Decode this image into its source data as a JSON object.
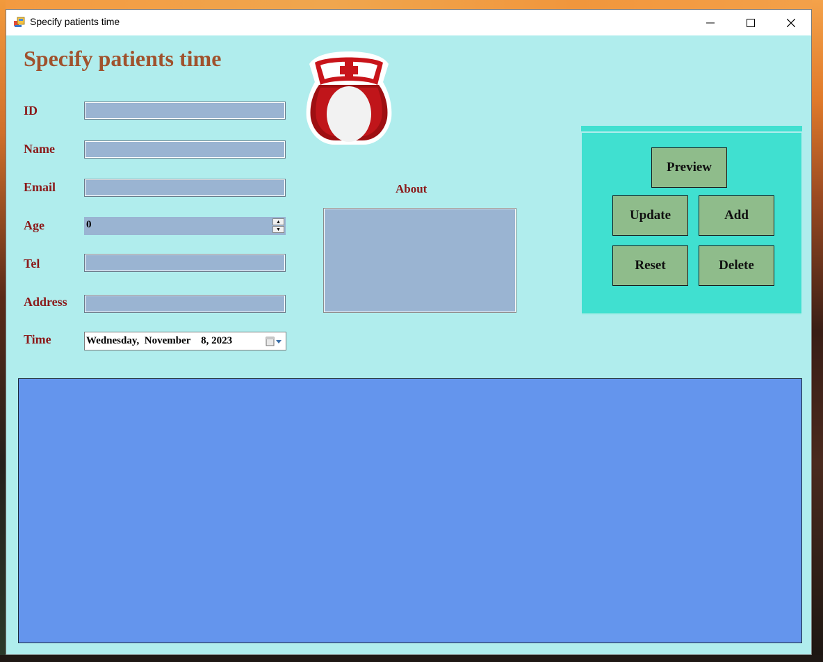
{
  "window": {
    "title": "Specify patients time"
  },
  "form": {
    "heading": "Specify patients time",
    "labels": {
      "id": "ID",
      "name": "Name",
      "email": "Email",
      "age": "Age",
      "tel": "Tel",
      "address": "Address",
      "time": "Time",
      "about": "About"
    },
    "values": {
      "id": "",
      "name": "",
      "email": "",
      "age": "0",
      "tel": "",
      "address": "",
      "time": "Wednesday,  November    8, 2023",
      "about": ""
    }
  },
  "actions": {
    "preview": "Preview",
    "update": "Update",
    "add": "Add",
    "reset": "Reset",
    "delete": "Delete"
  },
  "colors": {
    "form_background": "#b0eded",
    "heading": "#a0522d",
    "label": "#8b1a1a",
    "field": "#9ab4d2",
    "button_panel": "#40e0d0",
    "button": "#8fbc8b",
    "grid": "#6495ed"
  },
  "icons": {
    "app": "winforms-app-icon",
    "logo": "nurse-icon",
    "age_spinner": "spinner-arrows-icon",
    "time_dropdown": "calendar-dropdown-icon"
  }
}
